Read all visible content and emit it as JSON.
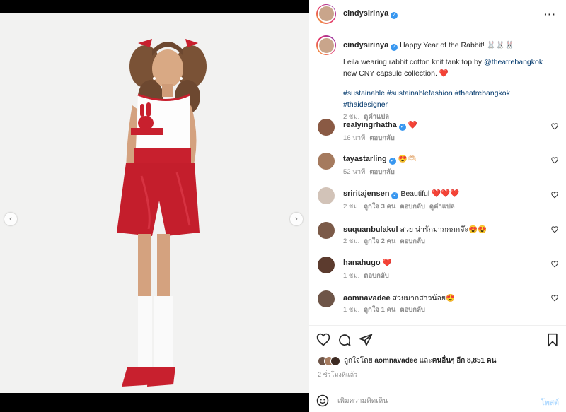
{
  "post": {
    "username": "cindysirinya",
    "more_icon": "more-horizontal-icon"
  },
  "caption": {
    "username": "cindysirinya",
    "title": "Happy Year of the Rabbit! 🐰🐰🐰",
    "body_prefix": "Leila wearing rabbit cotton knit tank top by ",
    "mention": "@theatrebangkok",
    "body_suffix": " new CNY capsule collection. ❤️",
    "hashtags": "#sustainable #sustainablefashion #theatrebangkok #thaidesigner",
    "time": "2 ชม.",
    "translate": "ดูคำแปล"
  },
  "comments": [
    {
      "username": "realyingrhatha",
      "verified": true,
      "text": "❤️",
      "time": "16 นาที",
      "likes": "",
      "reply": "ตอบกลับ",
      "translate": "",
      "avatar_color": "#8a5a44"
    },
    {
      "username": "tayastarling",
      "verified": true,
      "text": "😍🫶🏻",
      "time": "52 นาที",
      "likes": "",
      "reply": "ตอบกลับ",
      "translate": "",
      "avatar_color": "#a57a5e"
    },
    {
      "username": "sriritajensen",
      "verified": true,
      "text": "Beautiful ❤️❤️❤️",
      "time": "2 ชม.",
      "likes": "ถูกใจ 3 คน",
      "reply": "ตอบกลับ",
      "translate": "ดูคำแปล",
      "avatar_color": "#d2c3b8"
    },
    {
      "username": "suquanbulakul",
      "verified": false,
      "text": "สวย น่ารักมากกกกจ๊ะ😍😍",
      "time": "2 ชม.",
      "likes": "ถูกใจ 2 คน",
      "reply": "ตอบกลับ",
      "translate": "",
      "avatar_color": "#7b5a48"
    },
    {
      "username": "hanahugo",
      "verified": false,
      "text": "❤️",
      "time": "1 ชม.",
      "likes": "",
      "reply": "ตอบกลับ",
      "translate": "",
      "avatar_color": "#5c3b2e"
    },
    {
      "username": "aomnavadee",
      "verified": false,
      "text": "สวยมากสาวน้อย😍",
      "time": "1 ชม.",
      "likes": "ถูกใจ 1 คน",
      "reply": "ตอบกลับ",
      "translate": "",
      "avatar_color": "#6e5548"
    }
  ],
  "likes": {
    "prefix": "ถูกใจโดย ",
    "user": "aomnavadee",
    "mid": " และ",
    "others": "คนอื่นๆ อีก 8,851 คน"
  },
  "time_ago": "2 ชั่วโมงที่แล้ว",
  "comment_box": {
    "placeholder": "เพิ่มความคิดเห็น",
    "post_label": "โพสต์"
  },
  "colors": {
    "verified": "#3897f0",
    "heart": "#ed4956",
    "link": "#00376b",
    "post_button": "#b3dbff"
  },
  "icons": [
    "heart-icon",
    "comment-icon",
    "share-icon",
    "bookmark-icon",
    "emoji-icon",
    "chevron-left-icon",
    "chevron-right-icon"
  ]
}
